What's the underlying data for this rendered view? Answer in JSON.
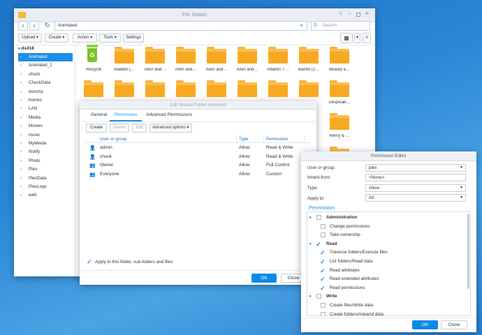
{
  "file_station": {
    "title": "File Station",
    "path": "Animated",
    "search_placeholder": "Search",
    "toolbar": {
      "upload": "Upload ▾",
      "create": "Create ▾",
      "action": "Action ▾",
      "tools": "Tools ▾",
      "settings": "Settings"
    },
    "tree_root": "ds418",
    "tree": [
      "Animated",
      "Animated_1",
      "chuck",
      "ChuckData",
      "dummy",
      "homes",
      "LAN",
      "Media",
      "Movies",
      "music",
      "MyMedia",
      "Notify",
      "Photo",
      "Plex",
      "PlexData",
      "PlexLogs",
      "web"
    ],
    "files_row1": [
      "#recycle",
      "Aladdin (…",
      "Alvin and…",
      "Alvin and…",
      "Alvin and…",
      "Alvin and…",
      "Atlantis T…",
      "Bambi (1…",
      "Beauty a…"
    ],
    "file_side_labels": [
      "Despicab…",
      "Henry & …"
    ]
  },
  "shared_folder": {
    "title": "Edit Shared Folder Animated",
    "tabs": [
      "General",
      "Permission",
      "Advanced Permissions"
    ],
    "buttons": {
      "create": "Create",
      "delete": "Delete",
      "edit": "Edit",
      "advanced": "Advanced options ▾"
    },
    "columns": [
      "User or group",
      "Type",
      "Permission"
    ],
    "rows": [
      {
        "name": "admin",
        "type": "Allow",
        "permission": "Read & Write"
      },
      {
        "name": "chuck",
        "type": "Allow",
        "permission": "Read & Write"
      },
      {
        "name": "Owner",
        "type": "Allow",
        "permission": "Full Control"
      },
      {
        "name": "Everyone",
        "type": "Allow",
        "permission": "Custom"
      }
    ],
    "apply_label": "Apply to this folder, sub-folders and files",
    "ok": "OK",
    "close": "Close"
  },
  "permission_editor": {
    "title": "Permission Editor",
    "user_label": "User or group:",
    "user_value": "plex",
    "inherit_label": "Inherit from:",
    "inherit_value": "<None>",
    "type_label": "Type:",
    "type_value": "Allow",
    "apply_label": "Apply to:",
    "apply_value": "All",
    "section": "Permission",
    "groups": [
      {
        "name": "Administration",
        "checked": false,
        "items": [
          {
            "label": "Change permissions",
            "checked": false
          },
          {
            "label": "Take ownership",
            "checked": false
          }
        ]
      },
      {
        "name": "Read",
        "checked": true,
        "items": [
          {
            "label": "Traverse folders/Execute files",
            "checked": true
          },
          {
            "label": "List folders/Read data",
            "checked": true
          },
          {
            "label": "Read attributes",
            "checked": true
          },
          {
            "label": "Read extended attributes",
            "checked": true
          },
          {
            "label": "Read permissions",
            "checked": true
          }
        ]
      },
      {
        "name": "Write",
        "checked": false,
        "items": [
          {
            "label": "Create files/Write data",
            "checked": false
          },
          {
            "label": "Create folders/Append data",
            "checked": false
          }
        ]
      }
    ],
    "ok": "OK",
    "close": "Close"
  },
  "colors": {
    "accent": "#1e8fe8",
    "folder": "#f8a922",
    "desktop": "#2a86d6"
  }
}
